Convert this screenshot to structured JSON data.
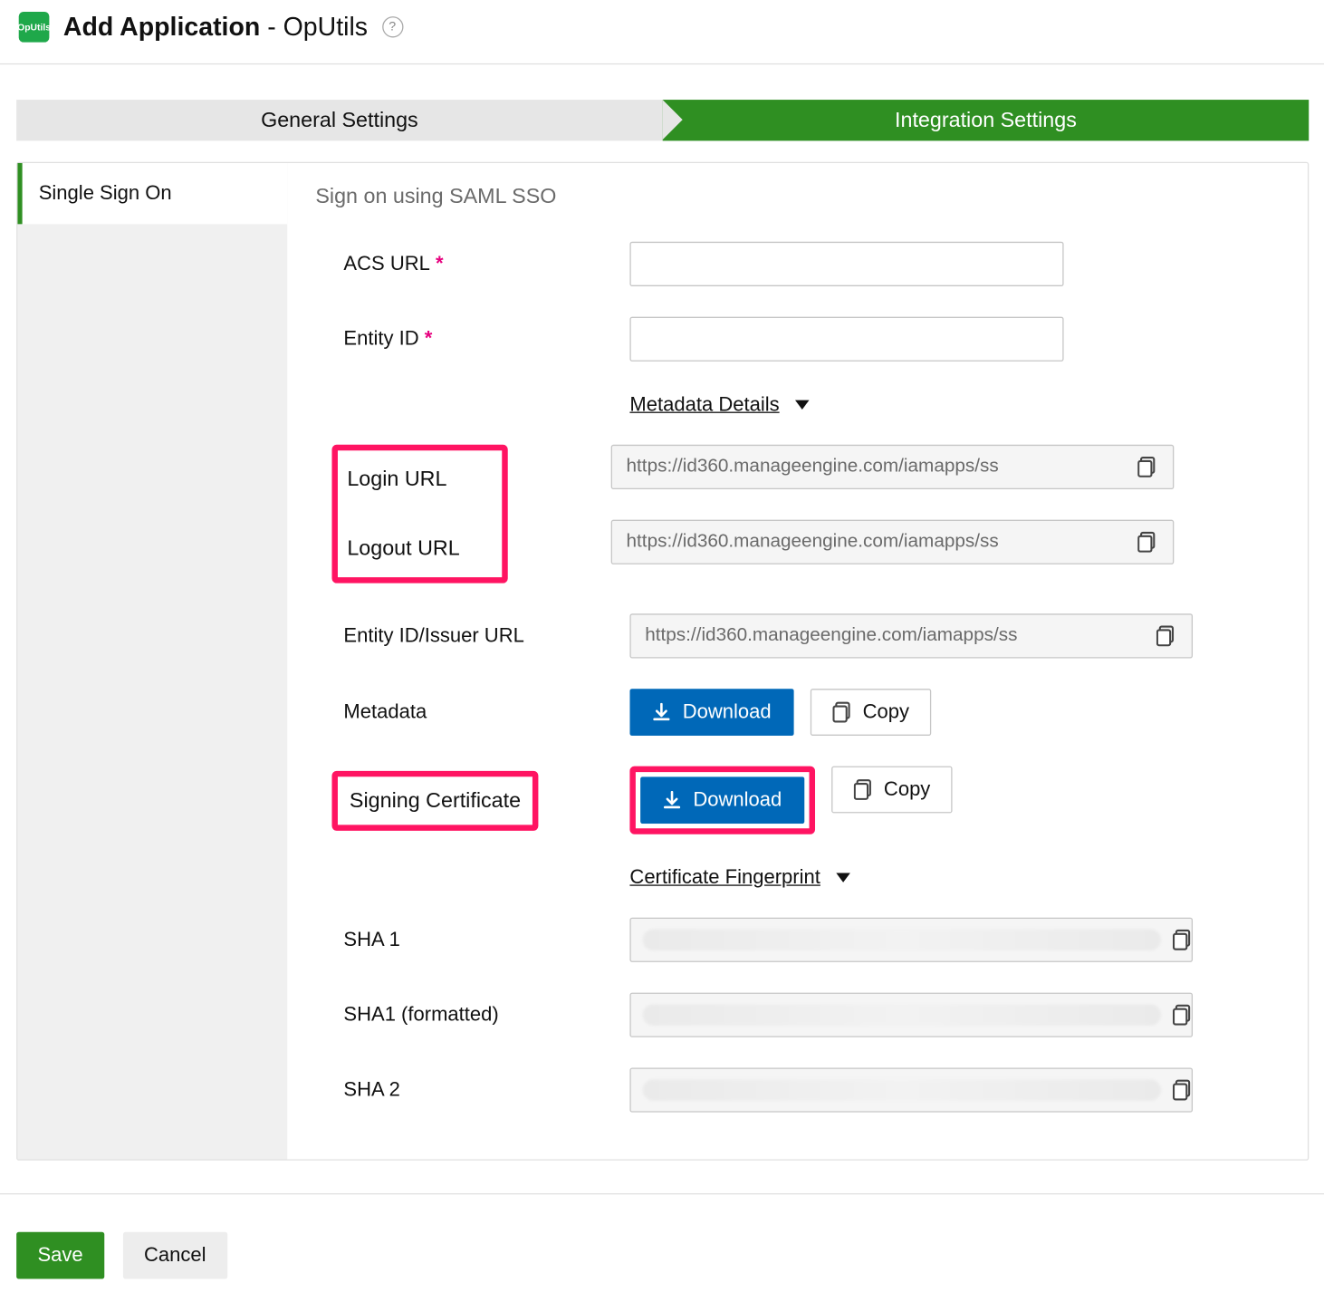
{
  "header": {
    "title_bold": "Add Application",
    "sep": " - ",
    "app_name": "OpUtils",
    "icon_label": "OpUtils"
  },
  "stepper": {
    "general": "General Settings",
    "integration": "Integration Settings"
  },
  "sidebar": {
    "sso": "Single Sign On"
  },
  "form": {
    "subtitle": "Sign on using SAML SSO",
    "acs_label": "ACS URL",
    "acs_value": "",
    "entity_label": "Entity ID",
    "entity_value": "",
    "metadata_details": "Metadata Details",
    "login_label": "Login URL",
    "login_value": "https://id360.manageengine.com/iamapps/ss",
    "logout_label": "Logout URL",
    "logout_value": "https://id360.manageengine.com/iamapps/ss",
    "issuer_label": "Entity ID/Issuer URL",
    "issuer_value": "https://id360.manageengine.com/iamapps/ss",
    "metadata_label": "Metadata",
    "signing_label": "Signing Certificate",
    "download_btn": "Download",
    "copy_btn": "Copy",
    "cert_fp": "Certificate Fingerprint",
    "sha1_label": "SHA 1",
    "sha1f_label": "SHA1 (formatted)",
    "sha2_label": "SHA 2"
  },
  "footer": {
    "save": "Save",
    "cancel": "Cancel"
  }
}
